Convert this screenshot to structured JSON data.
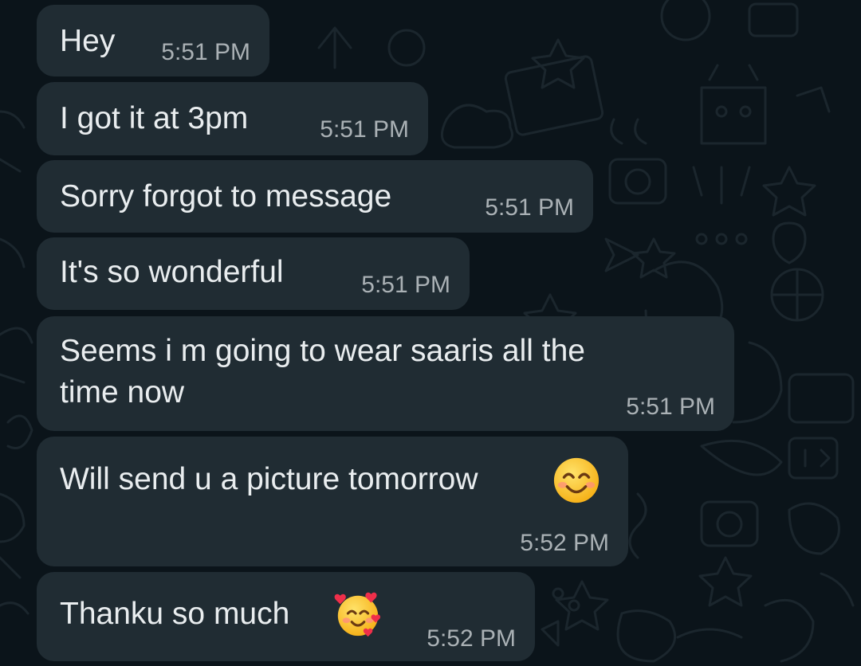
{
  "conversation": {
    "messages": [
      {
        "text": "Hey",
        "time": "5:51 PM"
      },
      {
        "text": "I got it at 3pm",
        "time": "5:51 PM"
      },
      {
        "text": "Sorry forgot to message",
        "time": "5:51 PM"
      },
      {
        "text": "It's so wonderful",
        "time": "5:51 PM"
      },
      {
        "text_line1": "Seems i m going to wear saaris all the",
        "text_line2": "time now",
        "time": "5:51 PM"
      },
      {
        "text": "Will send u a picture tomorrow",
        "emoji": "smiling-face-with-smiling-eyes-icon",
        "time": "5:52 PM"
      },
      {
        "text": "Thanku so much",
        "emoji": "smiling-face-with-hearts-icon",
        "time": "5:52 PM"
      }
    ]
  },
  "colors": {
    "background": "#0b141a",
    "bubble": "#202c33",
    "text": "#e9edef",
    "timestamp": "#aab1b5",
    "wallpaper_doodle": "#1b262d"
  }
}
